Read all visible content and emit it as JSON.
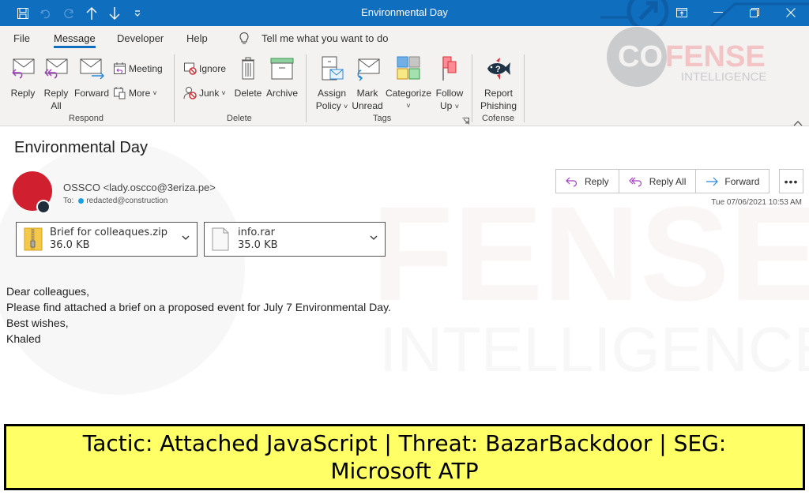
{
  "window": {
    "title": "Environmental Day",
    "quick_access": [
      "save-icon",
      "undo-icon",
      "redo-icon",
      "previous-item-icon",
      "next-item-icon",
      "customize-toolbar-icon"
    ],
    "controls": [
      "ribbon-display-options-icon",
      "minimize-icon",
      "restore-icon",
      "close-icon"
    ]
  },
  "menu": {
    "tabs": [
      "File",
      "Message",
      "Developer",
      "Help"
    ],
    "active_tab": "Message",
    "tell_me": "Tell me what you want to do"
  },
  "ribbon": {
    "respond": {
      "label": "Respond",
      "reply": "Reply",
      "reply_all_1": "Reply",
      "reply_all_2": "All",
      "forward": "Forward",
      "meeting": "Meeting",
      "more": "More"
    },
    "delete": {
      "label": "Delete",
      "ignore": "Ignore",
      "junk": "Junk",
      "delete": "Delete",
      "archive": "Archive"
    },
    "tags": {
      "label": "Tags",
      "assign_policy_1": "Assign",
      "assign_policy_2": "Policy",
      "mark_unread_1": "Mark",
      "mark_unread_2": "Unread",
      "categorize": "Categorize",
      "follow_up_1": "Follow",
      "follow_up_2": "Up"
    },
    "cofense": {
      "label": "Cofense",
      "report_1": "Report",
      "report_2": "Phishing"
    }
  },
  "logo": {
    "co": "CO",
    "fense": "FENSE",
    "sub": "INTELLIGENCE"
  },
  "email": {
    "subject": "Environmental Day",
    "sender": "OSSCO <lady.oscco@3eriza.pe>",
    "to_label": "To:",
    "to": "redacted@construction",
    "date": "Tue 07/06/2021 10:53 AM",
    "actions": {
      "reply": "Reply",
      "reply_all": "Reply All",
      "forward": "Forward",
      "more": "•••"
    },
    "attachments": [
      {
        "name": "Brief for colleaques.zip",
        "size": "36.0 KB",
        "type": "zip"
      },
      {
        "name": "info.rar",
        "size": "35.0 KB",
        "type": "file"
      }
    ],
    "body": [
      "Dear colleagues,",
      "Please find attached a brief on a proposed event for July 7 Environmental Day.",
      "Best wishes,",
      "Khaled"
    ]
  },
  "banner": {
    "text": "Tactic: Attached JavaScript | Threat: BazarBackdoor | SEG: Microsoft ATP"
  },
  "colors": {
    "titlebar": "#106ebe",
    "ribbon": "#f3f2f1",
    "avatar": "#d01f2e",
    "banner": "#ffff66",
    "reply_accent": "#a23cc2",
    "forward_accent": "#2b88d8"
  }
}
